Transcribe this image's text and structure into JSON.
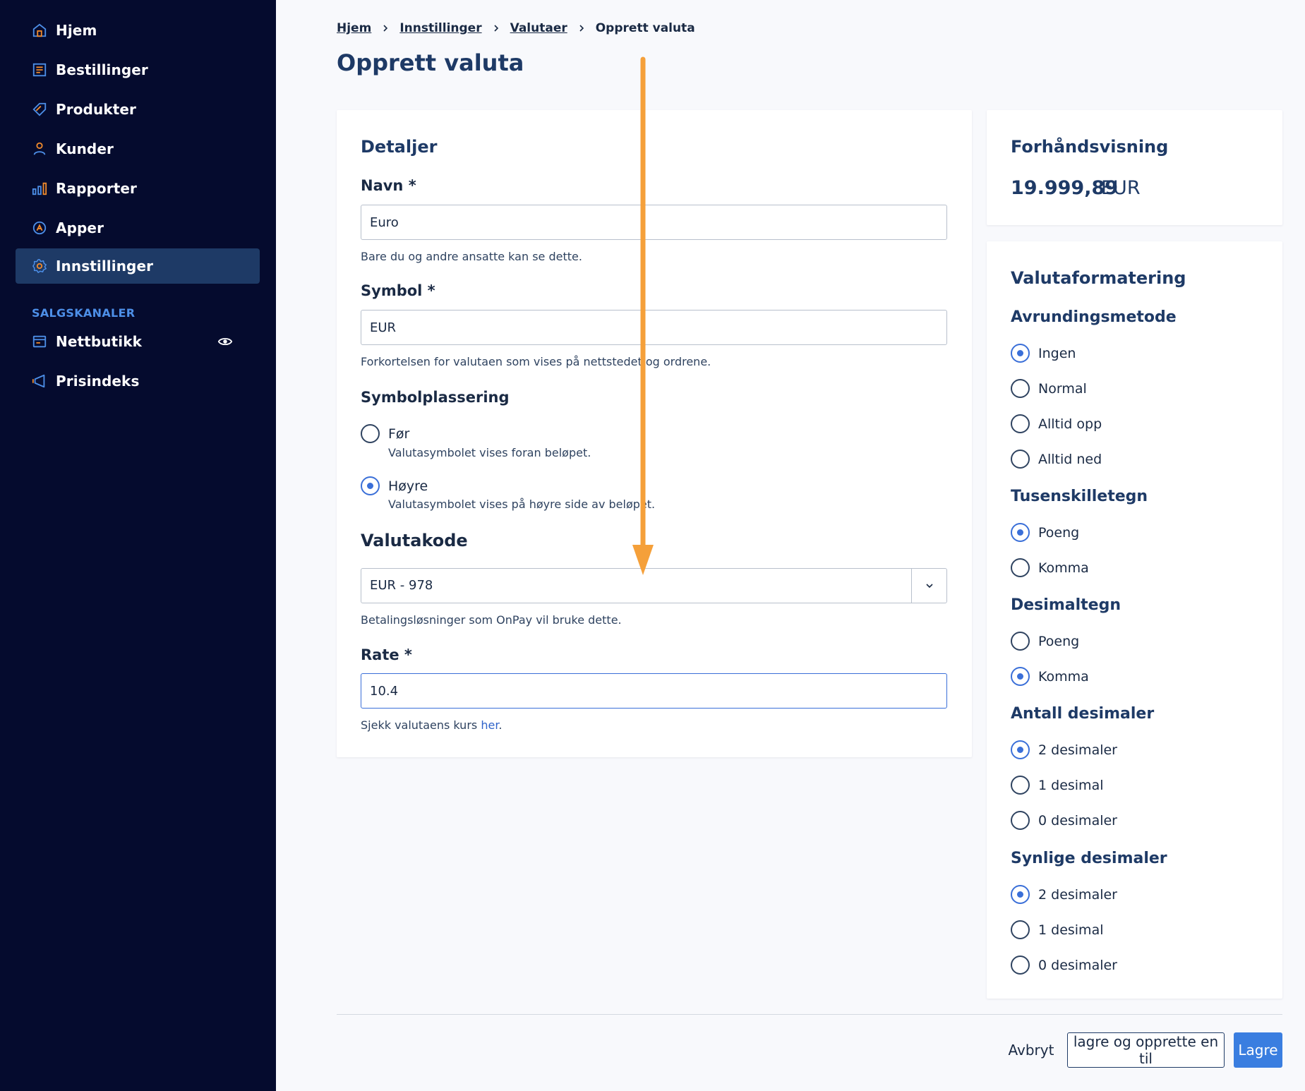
{
  "sidebar": {
    "items": [
      {
        "label": "Hjem",
        "icon": "home-icon"
      },
      {
        "label": "Bestillinger",
        "icon": "orders-icon"
      },
      {
        "label": "Produkter",
        "icon": "tag-icon"
      },
      {
        "label": "Kunder",
        "icon": "user-icon"
      },
      {
        "label": "Rapporter",
        "icon": "bar-chart-icon"
      },
      {
        "label": "Apper",
        "icon": "apps-icon"
      },
      {
        "label": "Innstillinger",
        "icon": "gear-icon",
        "active": true
      }
    ],
    "section_label": "SALGSKANALER",
    "channels": [
      {
        "label": "Nettbutikk",
        "icon": "store-icon"
      },
      {
        "label": "Prisindeks",
        "icon": "megaphone-icon"
      }
    ]
  },
  "breadcrumb": {
    "items": [
      "Hjem",
      "Innstillinger",
      "Valutaer"
    ],
    "current": "Opprett valuta"
  },
  "page_title": "Opprett valuta",
  "details": {
    "title": "Detaljer",
    "name": {
      "label": "Navn *",
      "value": "Euro",
      "help": "Bare du og andre ansatte kan se dette."
    },
    "symbol": {
      "label": "Symbol *",
      "value": "EUR",
      "help": "Forkortelsen for valutaen som vises på nettstedet og ordrene."
    },
    "placement": {
      "label": "Symbolplassering",
      "options": [
        {
          "label": "Før",
          "desc": "Valutasymbolet vises foran beløpet.",
          "checked": false
        },
        {
          "label": "Høyre",
          "desc": "Valutasymbolet vises på høyre side av beløpet.",
          "checked": true
        }
      ]
    },
    "currency_code": {
      "label": "Valutakode",
      "value": "EUR - 978",
      "help": "Betalingsløsninger som OnPay vil bruke dette."
    },
    "rate": {
      "label": "Rate *",
      "value": "10.4",
      "help_prefix": "Sjekk valutaens kurs ",
      "help_link": "her",
      "help_suffix": "."
    }
  },
  "preview": {
    "title": "Forhåndsvisning",
    "amount": "19.999,89",
    "currency": "EUR"
  },
  "formatting": {
    "title": "Valutaformatering",
    "rounding": {
      "label": "Avrundingsmetode",
      "options": [
        "Ingen",
        "Normal",
        "Alltid opp",
        "Alltid ned"
      ],
      "selected": 0
    },
    "thousands": {
      "label": "Tusenskilletegn",
      "options": [
        "Poeng",
        "Komma"
      ],
      "selected": 0
    },
    "decimal": {
      "label": "Desimaltegn",
      "options": [
        "Poeng",
        "Komma"
      ],
      "selected": 1
    },
    "decimals_count": {
      "label": "Antall desimaler",
      "options": [
        "2 desimaler",
        "1 desimal",
        "0 desimaler"
      ],
      "selected": 0
    },
    "visible_decimals": {
      "label": "Synlige desimaler",
      "options": [
        "2 desimaler",
        "1 desimal",
        "0 desimaler"
      ],
      "selected": 0
    }
  },
  "footer": {
    "cancel": "Avbryt",
    "save_and_new": "lagre og opprette en til",
    "save": "Lagre"
  },
  "colors": {
    "sidebar_bg": "#050b2e",
    "active_bg": "#1e3a66",
    "accent": "#3a7ee0",
    "icon_blue": "#4d8fe8",
    "icon_orange": "#f08a2c",
    "annotation": "#f5a03a"
  }
}
